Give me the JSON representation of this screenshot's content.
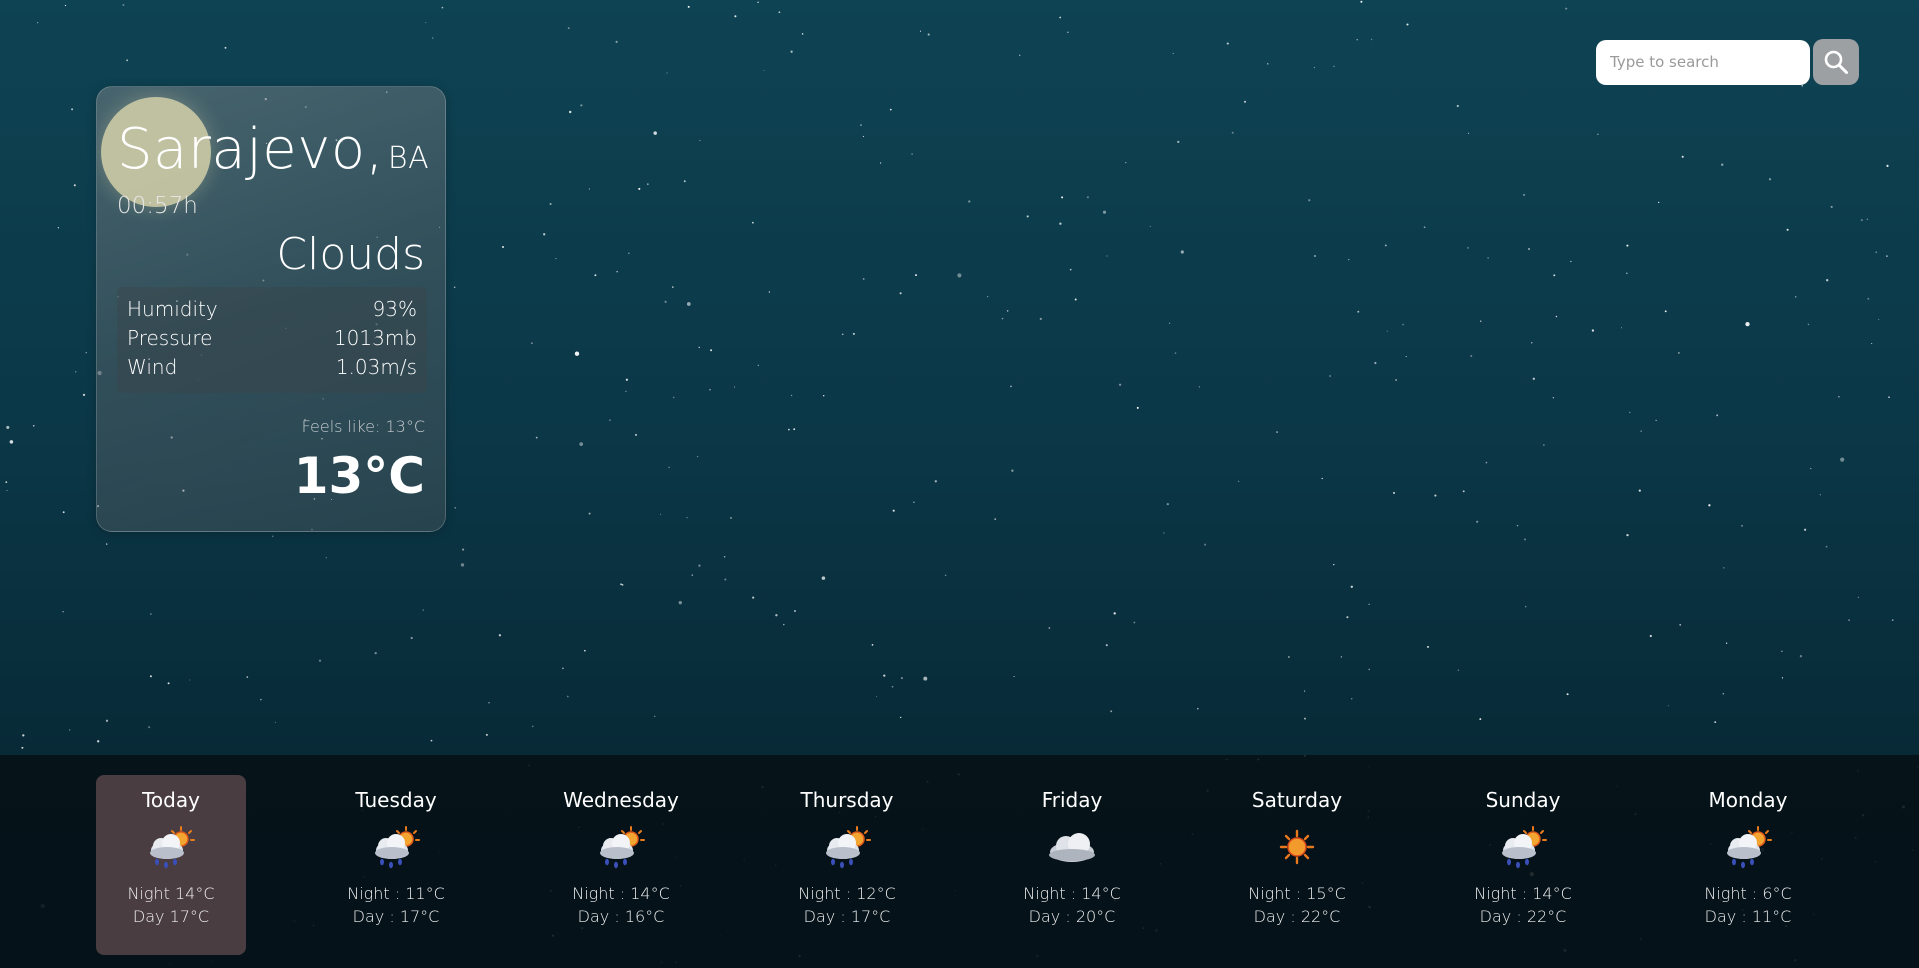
{
  "search": {
    "placeholder": "Type to search"
  },
  "icons": {
    "search": "search-icon",
    "sun": "sun-disc"
  },
  "current": {
    "city": "Sarajevo,",
    "country": "BA",
    "time": "00:57h",
    "condition": "Clouds",
    "humidity_label": "Humidity",
    "humidity_value": "93%",
    "pressure_label": "Pressure",
    "pressure_value": "1013mb",
    "wind_label": "Wind",
    "wind_value": "1.03m/s",
    "feels_like": "Feels like: 13°C",
    "temperature": "13°C"
  },
  "forecast": [
    {
      "day": "Today",
      "icon": "rain-cloud-sun-icon",
      "night": "Night 14°C",
      "dayTemp": "Day 17°C",
      "active": true
    },
    {
      "day": "Tuesday",
      "icon": "rain-cloud-sun-icon",
      "night": "Night : 11°C",
      "dayTemp": "Day : 17°C"
    },
    {
      "day": "Wednesday",
      "icon": "rain-cloud-sun-icon",
      "night": "Night : 14°C",
      "dayTemp": "Day : 16°C"
    },
    {
      "day": "Thursday",
      "icon": "rain-cloud-sun-icon",
      "night": "Night : 12°C",
      "dayTemp": "Day : 17°C"
    },
    {
      "day": "Friday",
      "icon": "cloud-icon",
      "night": "Night : 14°C",
      "dayTemp": "Day : 20°C"
    },
    {
      "day": "Saturday",
      "icon": "sun-icon",
      "night": "Night : 15°C",
      "dayTemp": "Day : 22°C"
    },
    {
      "day": "Sunday",
      "icon": "rain-cloud-sun-icon",
      "night": "Night : 14°C",
      "dayTemp": "Day : 22°C"
    },
    {
      "day": "Monday",
      "icon": "rain-cloud-sun-icon",
      "night": "Night : 6°C",
      "dayTemp": "Day : 11°C"
    }
  ],
  "colors": {
    "bg_top": "#0e4353",
    "bg_bottom": "#062330",
    "card": "#6e787c",
    "active_day": "#4a3d42",
    "search_button": "#9da0a3",
    "sun": "#d6d2aa"
  }
}
